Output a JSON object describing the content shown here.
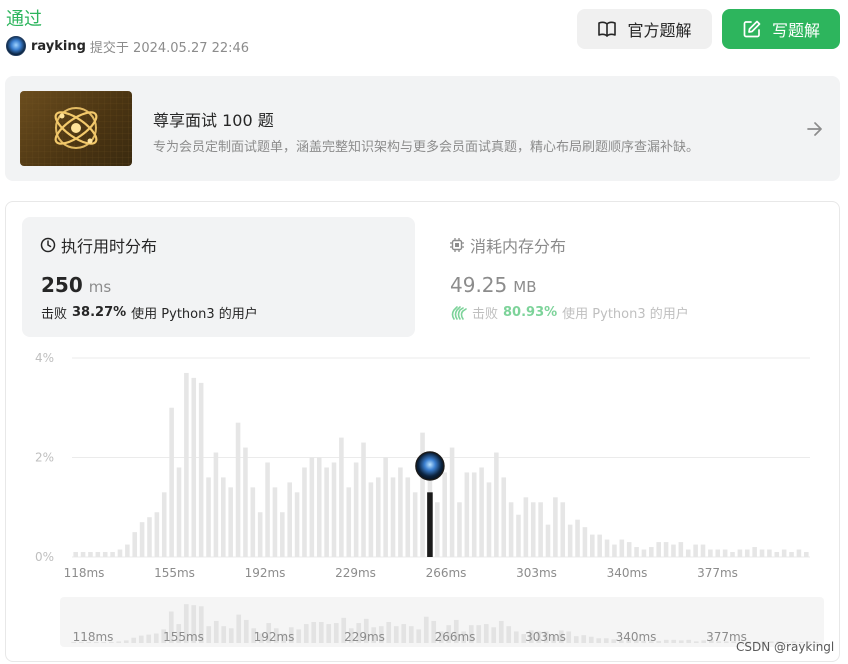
{
  "submission": {
    "status": "通过",
    "author": "rayking",
    "submitted_text": "提交于 2024.05.27 22:46"
  },
  "actions": {
    "official_solution": "官方题解",
    "write_solution": "写题解"
  },
  "banner": {
    "title": "尊享面试 100 题",
    "subtitle": "专为会员定制面试题单，涵盖完整知识架构与更多会员面试真题，精心布局刷题顺序查漏补缺。"
  },
  "runtime": {
    "title": "执行用时分布",
    "value": "250",
    "unit": "ms",
    "beat_prefix": "击败",
    "beat_percent": "38.27%",
    "beat_suffix": "使用 Python3 的用户"
  },
  "memory": {
    "title": "消耗内存分布",
    "value": "49.25",
    "unit": "MB",
    "beat_prefix": "击败",
    "beat_percent": "80.93%",
    "beat_suffix": "使用 Python3 的用户"
  },
  "colors": {
    "accent_green": "#2db55d",
    "bar_gray": "#e6e6e6",
    "marker_bar": "#1a1a1a"
  },
  "watermark": "CSDN @raykingl",
  "chart_data": {
    "type": "bar",
    "title": "",
    "xlabel": "",
    "ylabel": "",
    "ylim": [
      0,
      4
    ],
    "y_ticks": [
      "0%",
      "2%",
      "4%"
    ],
    "x_ticks": [
      "118ms",
      "155ms",
      "192ms",
      "229ms",
      "266ms",
      "303ms",
      "340ms",
      "377ms"
    ],
    "grid": true,
    "values": [
      0.1,
      0.1,
      0.1,
      0.1,
      0.1,
      0.1,
      0.15,
      0.25,
      0.5,
      0.7,
      0.8,
      0.9,
      1.3,
      3.0,
      1.8,
      3.7,
      3.6,
      3.5,
      1.6,
      2.1,
      1.6,
      1.4,
      2.7,
      2.2,
      1.4,
      0.9,
      1.9,
      1.4,
      0.9,
      1.5,
      1.3,
      1.8,
      2.0,
      2.0,
      1.8,
      1.9,
      2.4,
      1.4,
      1.9,
      2.3,
      1.5,
      1.6,
      2.0,
      1.6,
      1.8,
      1.6,
      1.3,
      2.5,
      2.1,
      1.1,
      1.7,
      2.2,
      1.1,
      1.7,
      1.7,
      1.8,
      1.5,
      2.1,
      1.6,
      1.1,
      0.85,
      1.2,
      1.1,
      1.1,
      0.65,
      1.2,
      1.1,
      0.65,
      0.75,
      0.6,
      0.45,
      0.45,
      0.35,
      0.25,
      0.35,
      0.3,
      0.2,
      0.15,
      0.2,
      0.3,
      0.3,
      0.25,
      0.3,
      0.15,
      0.25,
      0.25,
      0.15,
      0.15,
      0.15,
      0.1,
      0.15,
      0.15,
      0.2,
      0.15,
      0.15,
      0.1,
      0.15,
      0.1,
      0.15,
      0.1
    ],
    "highlight_index": 48,
    "highlight_value": 1.3
  }
}
